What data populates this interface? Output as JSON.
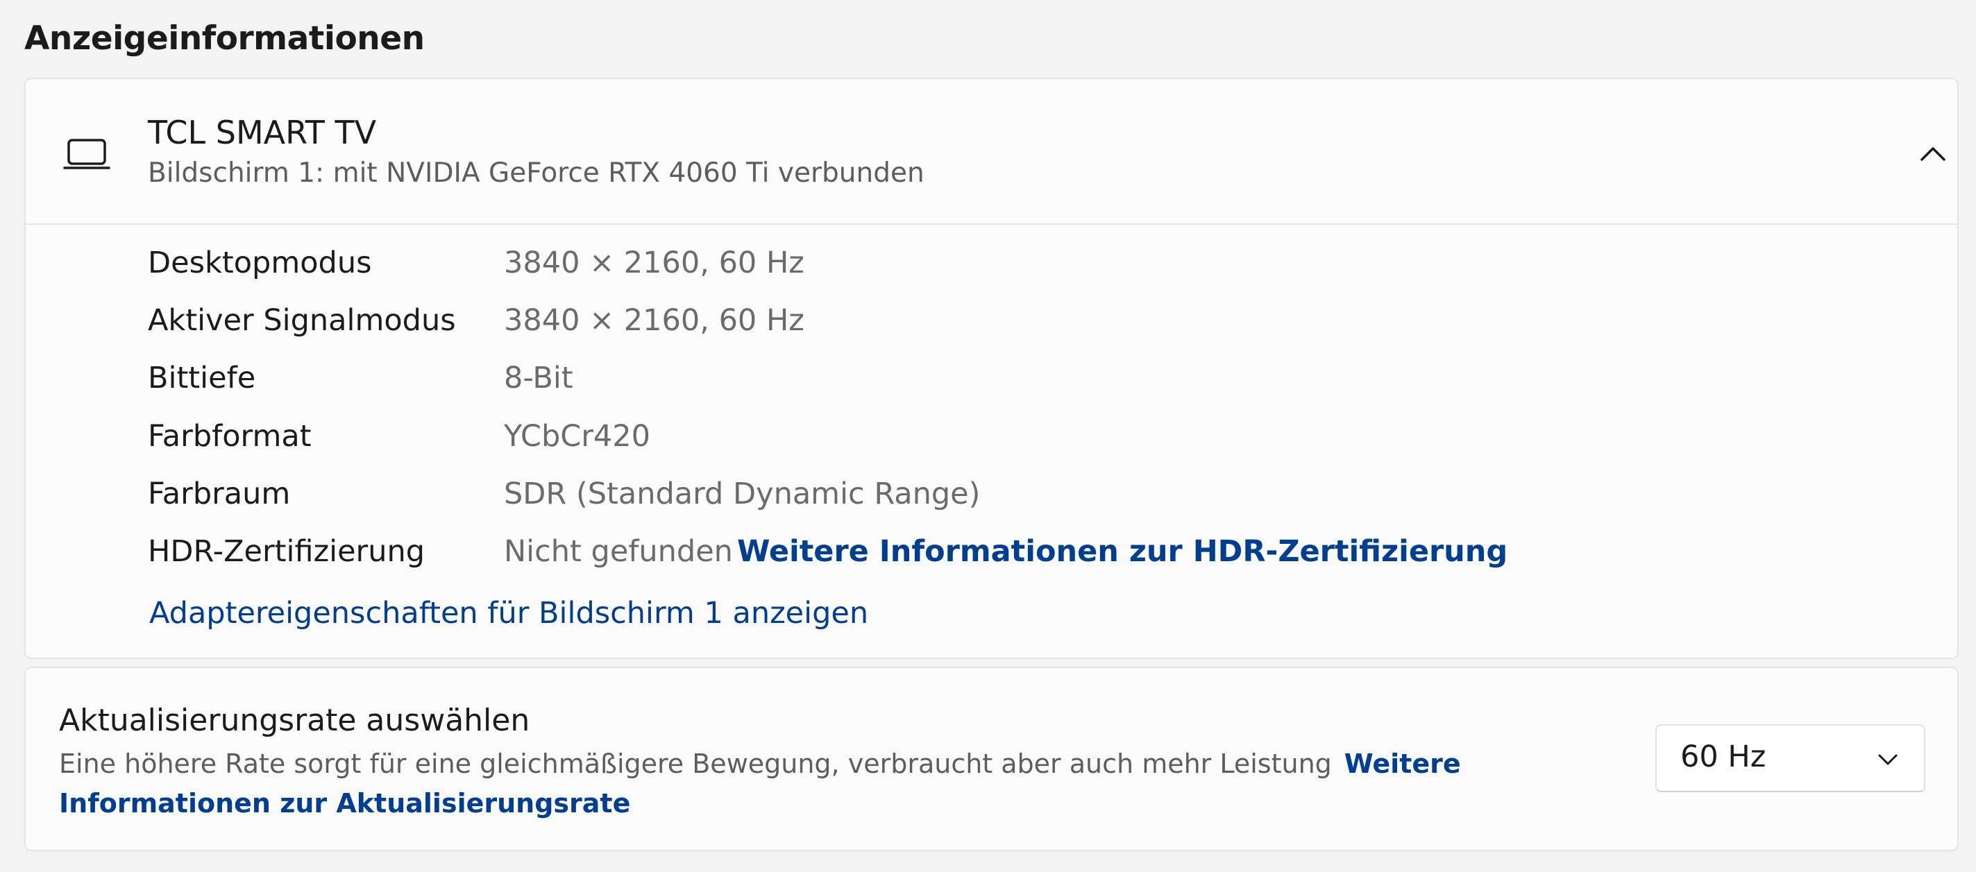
{
  "section_title": "Anzeigeinformationen",
  "display": {
    "icon": "laptop-icon",
    "name": "TCL SMART TV",
    "subtitle": "Bildschirm 1: mit NVIDIA GeForce RTX 4060 Ti verbunden",
    "expand_icon": "chevron-up-icon",
    "details": [
      {
        "label": "Desktopmodus",
        "value": "3840 × 2160, 60 Hz"
      },
      {
        "label": "Aktiver Signalmodus",
        "value": "3840 × 2160, 60 Hz"
      },
      {
        "label": "Bittiefe",
        "value": "8-Bit"
      },
      {
        "label": "Farbformat",
        "value": "YCbCr420"
      },
      {
        "label": "Farbraum",
        "value": "SDR (Standard Dynamic Range)"
      },
      {
        "label": "HDR-Zertifizierung",
        "value": "Nicht gefunden",
        "link": "Weitere Informationen zur HDR-Zertifizierung"
      }
    ],
    "adapter_link": "Adaptereigenschaften für Bildschirm 1 anzeigen"
  },
  "refresh": {
    "title": "Aktualisierungsrate auswählen",
    "description": "Eine höhere Rate sorgt für eine gleichmäßigere Bewegung, verbraucht aber auch mehr Leistung",
    "link": "Weitere Informationen zur Aktualisierungsrate",
    "selected": "60 Hz",
    "dropdown_icon": "chevron-down-icon"
  },
  "colors": {
    "background": "#f3f3f3",
    "card": "#fbfbfb",
    "link": "#003e92",
    "secondary_text": "#6b6b6b"
  }
}
